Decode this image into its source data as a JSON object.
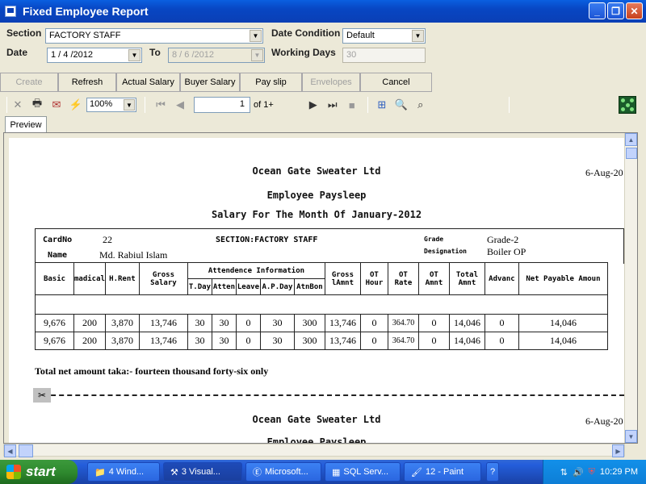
{
  "window": {
    "title": "Fixed Employee Report"
  },
  "filters": {
    "section_label": "Section",
    "section_value": "FACTORY STAFF",
    "date_condition_label": "Date Condition",
    "date_condition_value": "Default",
    "date_label": "Date",
    "date_from": "1 / 4 /2012",
    "to_label": "To",
    "date_to": "8 / 6 /2012",
    "working_days_label": "Working Days",
    "working_days_value": "30"
  },
  "buttons": [
    "Create",
    "Refresh",
    "Actual Salary",
    "Buyer Salary",
    "Pay slip",
    "Envelopes",
    "Cancel"
  ],
  "toolbar": {
    "zoom": "100%",
    "page": "1",
    "page_of": "of 1+"
  },
  "tab": "Preview",
  "report": {
    "company": "Ocean Gate Sweater Ltd",
    "date": "6-Aug-20",
    "doc_title": "Employee Paysleep",
    "month_title": "Salary For The Month Of January-2012",
    "card_label": "CardNo",
    "card_value": "22",
    "section": "SECTION:FACTORY STAFF",
    "grade_label": "Grade",
    "grade_value": "Grade-2",
    "designation_label": "Designation",
    "designation_value": "Boiler OP",
    "name_label": "Name",
    "name_value": "Md. Rabiul Islam",
    "headers": {
      "basic": "Basic",
      "medical": "madical",
      "hrent": "H.Rent",
      "gross": "Gross Salary",
      "attendance": "Attendence Information",
      "tday": "T.Day",
      "atten": "Atten",
      "leave": "Leave",
      "apday": "A.P.Day",
      "atnbon": "AtnBon",
      "gross_amnt": "Gross lAmnt",
      "ot_hour": "OT Hour",
      "ot_rate": "OT Rate",
      "ot_amnt": "OT Amnt",
      "total_amnt": "Total Amnt",
      "advance": "Advanc",
      "net_payable": "Net Payable Amoun"
    },
    "rows": [
      [
        "9,676",
        "200",
        "3,870",
        "13,746",
        "30",
        "30",
        "0",
        "30",
        "300",
        "13,746",
        "0",
        "364.70",
        "0",
        "14,046",
        "0",
        "14,046"
      ],
      [
        "9,676",
        "200",
        "3,870",
        "13,746",
        "30",
        "30",
        "0",
        "30",
        "300",
        "13,746",
        "0",
        "364.70",
        "0",
        "14,046",
        "0",
        "14,046"
      ]
    ],
    "total_words": "Total net amount taka:- fourteen thousand forty-six only",
    "company2": "Ocean Gate Sweater Ltd",
    "date2": "6-Aug-20",
    "doc_title2": "Employee Paysleep"
  },
  "taskbar": {
    "start": "start",
    "tasks": [
      "4 Wind...",
      "3 Visual...",
      "Microsoft...",
      "SQL Serv...",
      "12 - Paint"
    ],
    "clock": "10:29 PM"
  }
}
